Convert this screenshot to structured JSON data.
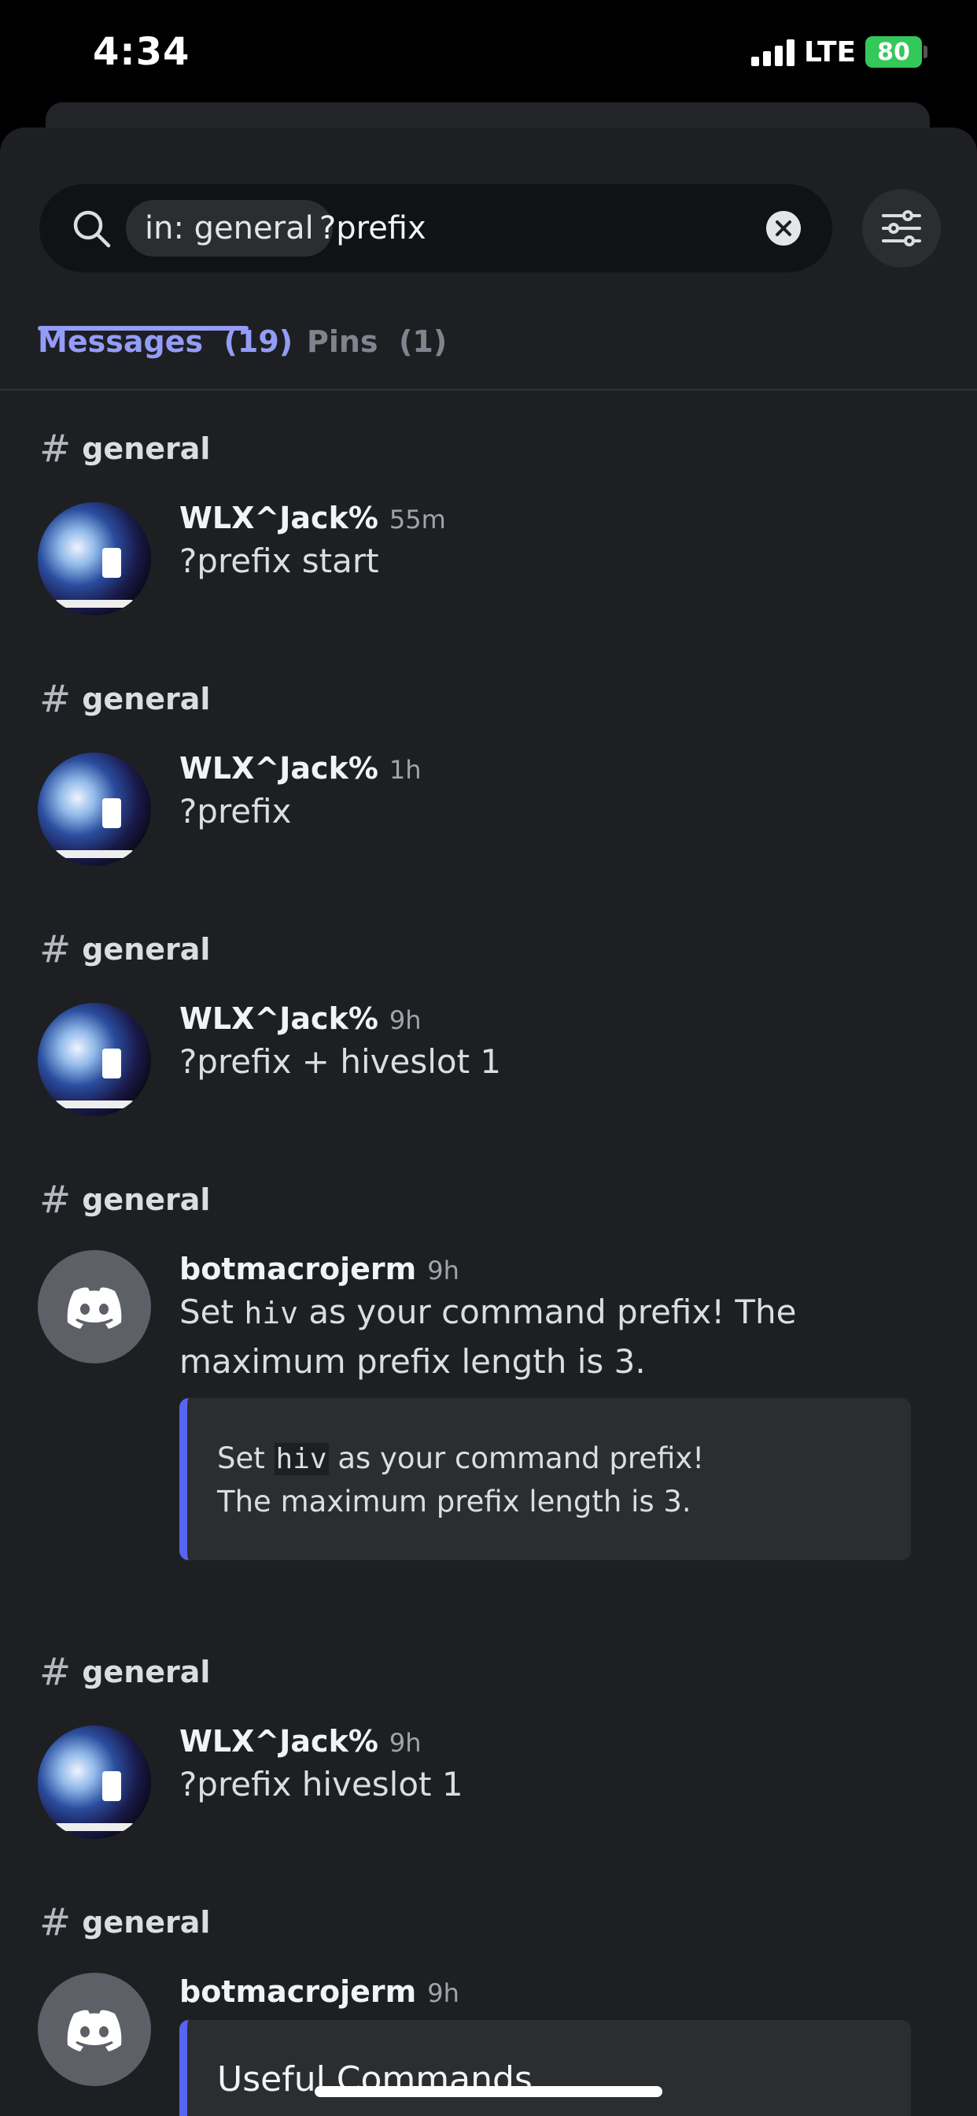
{
  "status_bar": {
    "time": "4:34",
    "network": "LTE",
    "battery": "80"
  },
  "search": {
    "scope_chip": "in: general",
    "query": "?prefix"
  },
  "tabs": [
    {
      "label": "Messages",
      "count": "(19)"
    },
    {
      "label": "Pins",
      "count": "(1)"
    }
  ],
  "results": [
    {
      "channel": "general",
      "author": "WLX^Jack%",
      "time": "55m",
      "text": "?prefix start"
    },
    {
      "channel": "general",
      "author": "WLX^Jack%",
      "time": "1h",
      "text": "?prefix"
    },
    {
      "channel": "general",
      "author": "WLX^Jack%",
      "time": "9h",
      "text": "?prefix + hiveslot 1"
    },
    {
      "channel": "general",
      "author": "botmacrojerm",
      "time": "9h",
      "text_pre": "Set ",
      "text_code": "hiv",
      "text_post": " as your command prefix! The maximum prefix length is 3.",
      "embed": {
        "pre": "Set ",
        "code": "hiv",
        "mid": " as your command prefix!",
        "line2": "The maximum prefix length is 3."
      }
    },
    {
      "channel": "general",
      "author": "WLX^Jack%",
      "time": "9h",
      "text": "?prefix hiveslot 1"
    },
    {
      "channel": "general",
      "author": "botmacrojerm",
      "time": "9h",
      "embed_title": "Useful Commands"
    }
  ],
  "colors": {
    "accent": "#949cf7",
    "embed_bar": "#5865f2",
    "background": "#1e1f22"
  }
}
